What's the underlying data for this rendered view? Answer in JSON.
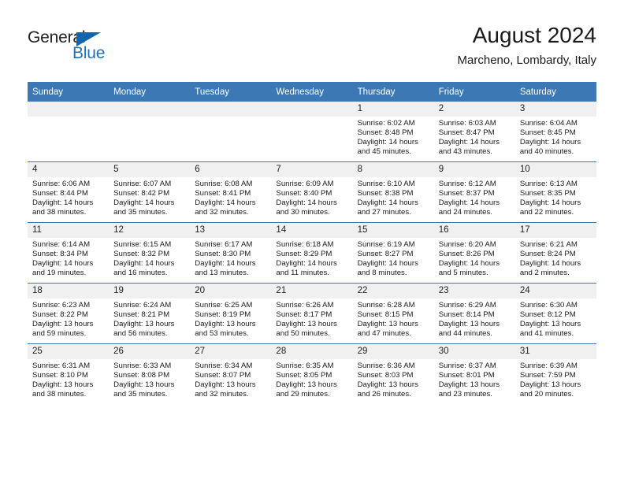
{
  "brand": {
    "name_part1": "General",
    "name_part2": "Blue"
  },
  "header": {
    "title": "August 2024",
    "subtitle": "Marcheno, Lombardy, Italy"
  },
  "weekday_headers": [
    "Sunday",
    "Monday",
    "Tuesday",
    "Wednesday",
    "Thursday",
    "Friday",
    "Saturday"
  ],
  "labels": {
    "sunrise_prefix": "Sunrise: ",
    "sunset_prefix": "Sunset: ",
    "daylight_prefix": "Daylight: "
  },
  "colors": {
    "header_blue": "#3b78b4",
    "daynum_band": "#f0f0f0",
    "brand_blue": "#1165ab",
    "text": "#1a1a1a"
  },
  "weeks": [
    [
      {
        "day": "",
        "empty": true
      },
      {
        "day": "",
        "empty": true
      },
      {
        "day": "",
        "empty": true
      },
      {
        "day": "",
        "empty": true
      },
      {
        "day": "1",
        "sunrise": "Sunrise: 6:02 AM",
        "sunset": "Sunset: 8:48 PM",
        "daylight_l1": "Daylight: 14 hours",
        "daylight_l2": "and 45 minutes."
      },
      {
        "day": "2",
        "sunrise": "Sunrise: 6:03 AM",
        "sunset": "Sunset: 8:47 PM",
        "daylight_l1": "Daylight: 14 hours",
        "daylight_l2": "and 43 minutes."
      },
      {
        "day": "3",
        "sunrise": "Sunrise: 6:04 AM",
        "sunset": "Sunset: 8:45 PM",
        "daylight_l1": "Daylight: 14 hours",
        "daylight_l2": "and 40 minutes."
      }
    ],
    [
      {
        "day": "4",
        "sunrise": "Sunrise: 6:06 AM",
        "sunset": "Sunset: 8:44 PM",
        "daylight_l1": "Daylight: 14 hours",
        "daylight_l2": "and 38 minutes."
      },
      {
        "day": "5",
        "sunrise": "Sunrise: 6:07 AM",
        "sunset": "Sunset: 8:42 PM",
        "daylight_l1": "Daylight: 14 hours",
        "daylight_l2": "and 35 minutes."
      },
      {
        "day": "6",
        "sunrise": "Sunrise: 6:08 AM",
        "sunset": "Sunset: 8:41 PM",
        "daylight_l1": "Daylight: 14 hours",
        "daylight_l2": "and 32 minutes."
      },
      {
        "day": "7",
        "sunrise": "Sunrise: 6:09 AM",
        "sunset": "Sunset: 8:40 PM",
        "daylight_l1": "Daylight: 14 hours",
        "daylight_l2": "and 30 minutes."
      },
      {
        "day": "8",
        "sunrise": "Sunrise: 6:10 AM",
        "sunset": "Sunset: 8:38 PM",
        "daylight_l1": "Daylight: 14 hours",
        "daylight_l2": "and 27 minutes."
      },
      {
        "day": "9",
        "sunrise": "Sunrise: 6:12 AM",
        "sunset": "Sunset: 8:37 PM",
        "daylight_l1": "Daylight: 14 hours",
        "daylight_l2": "and 24 minutes."
      },
      {
        "day": "10",
        "sunrise": "Sunrise: 6:13 AM",
        "sunset": "Sunset: 8:35 PM",
        "daylight_l1": "Daylight: 14 hours",
        "daylight_l2": "and 22 minutes."
      }
    ],
    [
      {
        "day": "11",
        "sunrise": "Sunrise: 6:14 AM",
        "sunset": "Sunset: 8:34 PM",
        "daylight_l1": "Daylight: 14 hours",
        "daylight_l2": "and 19 minutes."
      },
      {
        "day": "12",
        "sunrise": "Sunrise: 6:15 AM",
        "sunset": "Sunset: 8:32 PM",
        "daylight_l1": "Daylight: 14 hours",
        "daylight_l2": "and 16 minutes."
      },
      {
        "day": "13",
        "sunrise": "Sunrise: 6:17 AM",
        "sunset": "Sunset: 8:30 PM",
        "daylight_l1": "Daylight: 14 hours",
        "daylight_l2": "and 13 minutes."
      },
      {
        "day": "14",
        "sunrise": "Sunrise: 6:18 AM",
        "sunset": "Sunset: 8:29 PM",
        "daylight_l1": "Daylight: 14 hours",
        "daylight_l2": "and 11 minutes."
      },
      {
        "day": "15",
        "sunrise": "Sunrise: 6:19 AM",
        "sunset": "Sunset: 8:27 PM",
        "daylight_l1": "Daylight: 14 hours",
        "daylight_l2": "and 8 minutes."
      },
      {
        "day": "16",
        "sunrise": "Sunrise: 6:20 AM",
        "sunset": "Sunset: 8:26 PM",
        "daylight_l1": "Daylight: 14 hours",
        "daylight_l2": "and 5 minutes."
      },
      {
        "day": "17",
        "sunrise": "Sunrise: 6:21 AM",
        "sunset": "Sunset: 8:24 PM",
        "daylight_l1": "Daylight: 14 hours",
        "daylight_l2": "and 2 minutes."
      }
    ],
    [
      {
        "day": "18",
        "sunrise": "Sunrise: 6:23 AM",
        "sunset": "Sunset: 8:22 PM",
        "daylight_l1": "Daylight: 13 hours",
        "daylight_l2": "and 59 minutes."
      },
      {
        "day": "19",
        "sunrise": "Sunrise: 6:24 AM",
        "sunset": "Sunset: 8:21 PM",
        "daylight_l1": "Daylight: 13 hours",
        "daylight_l2": "and 56 minutes."
      },
      {
        "day": "20",
        "sunrise": "Sunrise: 6:25 AM",
        "sunset": "Sunset: 8:19 PM",
        "daylight_l1": "Daylight: 13 hours",
        "daylight_l2": "and 53 minutes."
      },
      {
        "day": "21",
        "sunrise": "Sunrise: 6:26 AM",
        "sunset": "Sunset: 8:17 PM",
        "daylight_l1": "Daylight: 13 hours",
        "daylight_l2": "and 50 minutes."
      },
      {
        "day": "22",
        "sunrise": "Sunrise: 6:28 AM",
        "sunset": "Sunset: 8:15 PM",
        "daylight_l1": "Daylight: 13 hours",
        "daylight_l2": "and 47 minutes."
      },
      {
        "day": "23",
        "sunrise": "Sunrise: 6:29 AM",
        "sunset": "Sunset: 8:14 PM",
        "daylight_l1": "Daylight: 13 hours",
        "daylight_l2": "and 44 minutes."
      },
      {
        "day": "24",
        "sunrise": "Sunrise: 6:30 AM",
        "sunset": "Sunset: 8:12 PM",
        "daylight_l1": "Daylight: 13 hours",
        "daylight_l2": "and 41 minutes."
      }
    ],
    [
      {
        "day": "25",
        "sunrise": "Sunrise: 6:31 AM",
        "sunset": "Sunset: 8:10 PM",
        "daylight_l1": "Daylight: 13 hours",
        "daylight_l2": "and 38 minutes."
      },
      {
        "day": "26",
        "sunrise": "Sunrise: 6:33 AM",
        "sunset": "Sunset: 8:08 PM",
        "daylight_l1": "Daylight: 13 hours",
        "daylight_l2": "and 35 minutes."
      },
      {
        "day": "27",
        "sunrise": "Sunrise: 6:34 AM",
        "sunset": "Sunset: 8:07 PM",
        "daylight_l1": "Daylight: 13 hours",
        "daylight_l2": "and 32 minutes."
      },
      {
        "day": "28",
        "sunrise": "Sunrise: 6:35 AM",
        "sunset": "Sunset: 8:05 PM",
        "daylight_l1": "Daylight: 13 hours",
        "daylight_l2": "and 29 minutes."
      },
      {
        "day": "29",
        "sunrise": "Sunrise: 6:36 AM",
        "sunset": "Sunset: 8:03 PM",
        "daylight_l1": "Daylight: 13 hours",
        "daylight_l2": "and 26 minutes."
      },
      {
        "day": "30",
        "sunrise": "Sunrise: 6:37 AM",
        "sunset": "Sunset: 8:01 PM",
        "daylight_l1": "Daylight: 13 hours",
        "daylight_l2": "and 23 minutes."
      },
      {
        "day": "31",
        "sunrise": "Sunrise: 6:39 AM",
        "sunset": "Sunset: 7:59 PM",
        "daylight_l1": "Daylight: 13 hours",
        "daylight_l2": "and 20 minutes."
      }
    ]
  ]
}
